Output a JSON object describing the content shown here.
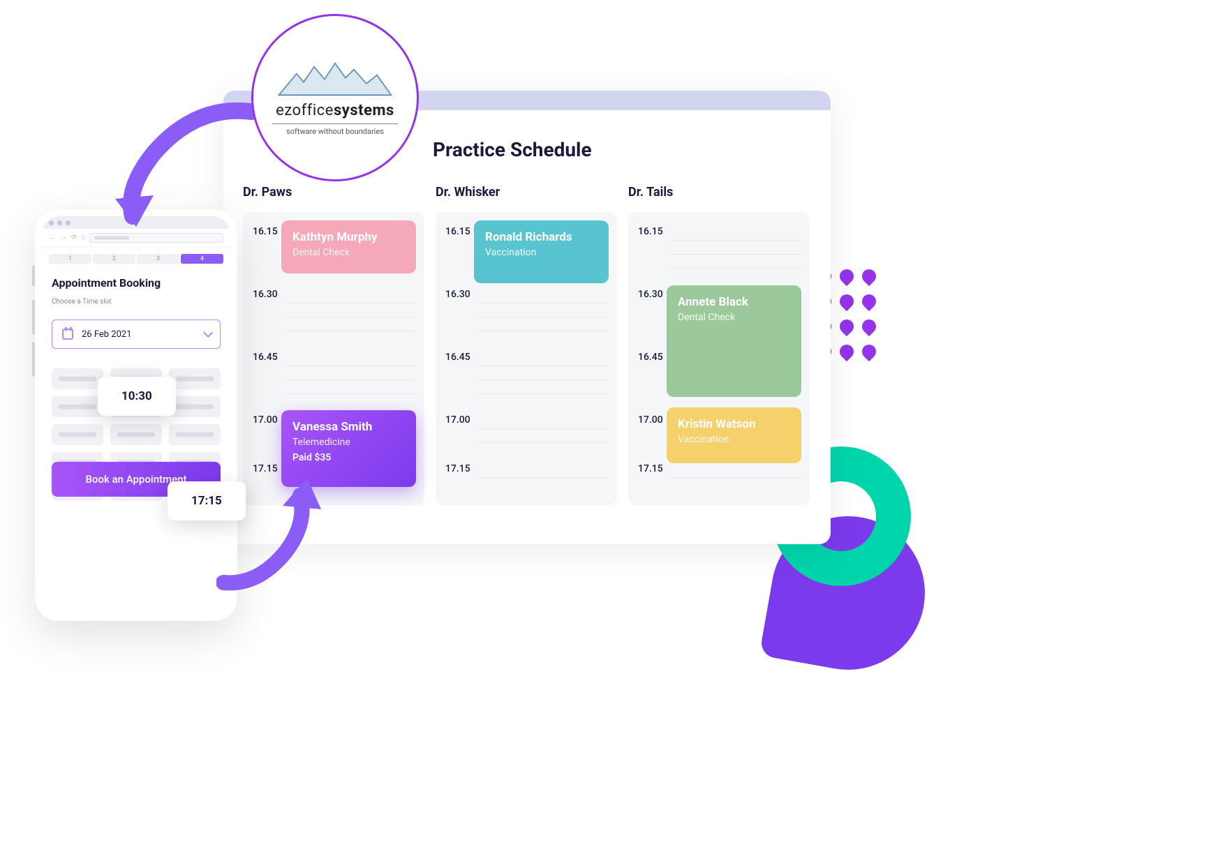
{
  "logo": {
    "name1": "ezoffice",
    "name2": "systems",
    "tagline": "software without boundaries"
  },
  "desktop": {
    "title": "Practice Schedule",
    "time_rows": [
      "16.15",
      "16.30",
      "16.45",
      "17.00",
      "17.15"
    ],
    "columns": [
      {
        "doctor": "Dr. Paws",
        "appointments": [
          {
            "name": "Kathtyn Murphy",
            "service": "Dental Check",
            "color": "pink",
            "pos": "slot1"
          },
          {
            "name": "Vanessa Smith",
            "service": "Telemedicine",
            "paid": "Paid $35",
            "color": "purple",
            "pos": "slot4"
          }
        ]
      },
      {
        "doctor": "Dr. Whisker",
        "appointments": [
          {
            "name": "Ronald Richards",
            "service": "Vaccination",
            "color": "teal",
            "pos": "slot1"
          }
        ]
      },
      {
        "doctor": "Dr. Tails",
        "appointments": [
          {
            "name": "Annete Black",
            "service": "Dental Check",
            "color": "green",
            "pos": "slot2"
          },
          {
            "name": "Kristin Watson",
            "service": "Vaccination",
            "color": "yellow",
            "pos": "slot4"
          }
        ]
      }
    ]
  },
  "phone": {
    "steps": [
      "1",
      "2",
      "3",
      "4"
    ],
    "active_step": "4",
    "heading": "Appointment Booking",
    "subheading": "Choose a Time slot",
    "date": "26 Feb 2021",
    "time_chip_1": "10:30",
    "time_chip_2": "17:15",
    "book_label": "Book an Appointment"
  }
}
